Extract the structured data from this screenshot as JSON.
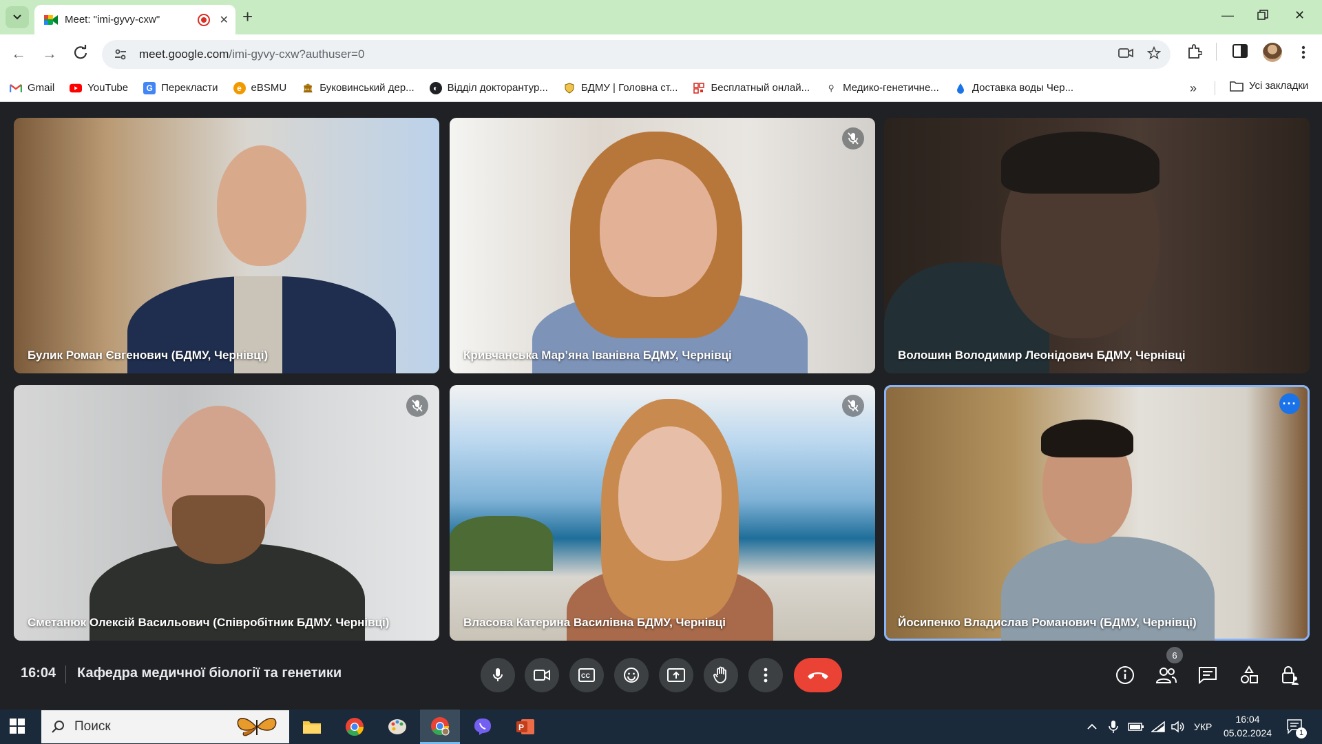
{
  "browser": {
    "tab_title": "Meet: \"imi-gyvy-cxw\"",
    "url_main": "meet.google.com",
    "url_path": "/imi-gyvy-cxw?authuser=0",
    "bookmarks": [
      {
        "label": "Gmail",
        "icon": "gmail-icon",
        "color": "#ea4335"
      },
      {
        "label": "YouTube",
        "icon": "youtube-icon",
        "color": "#ff0000"
      },
      {
        "label": "Перекласти",
        "icon": "translate-icon",
        "color": "#4285f4"
      },
      {
        "label": "eBSMU",
        "icon": "ebsmu-icon",
        "color": "#f29900"
      },
      {
        "label": "Буковинський дер...",
        "icon": "university-icon",
        "color": "#a06a00"
      },
      {
        "label": "Відділ докторантур...",
        "icon": "globe-icon",
        "color": "#202124"
      },
      {
        "label": "БДМУ | Головна ст...",
        "icon": "shield-icon",
        "color": "#b58100"
      },
      {
        "label": "Бесплатный онлай...",
        "icon": "qr-icon",
        "color": "#d93025"
      },
      {
        "label": "Медико-генетичне...",
        "icon": "dna-icon",
        "color": "#444444"
      },
      {
        "label": "Доставка воды Чер...",
        "icon": "water-drop-icon",
        "color": "#1a73e8"
      }
    ],
    "all_bookmarks": "Усі закладки"
  },
  "meet": {
    "participants": [
      {
        "name": "Булик Роман Євгенович (БДМУ, Чернівці)",
        "muted": false
      },
      {
        "name": "Кривчанська Мар’яна Іванівна БДМУ, Чернівці",
        "muted": true
      },
      {
        "name": "Волошин Володимир Леонідович БДМУ, Чернівці",
        "muted": false
      },
      {
        "name": "Сметанюк Олексій Васильович (Співробітник БДМУ. Чернівці)",
        "muted": true
      },
      {
        "name": "Власова Катерина Василівна БДМУ, Чернівці",
        "muted": true
      },
      {
        "name": "Йосипенко Владислав Романович (БДМУ, Чернівці)",
        "muted": false
      }
    ],
    "time": "16:04",
    "meeting_name": "Кафедра медичної біології та генетики",
    "people_count": "6",
    "accent_color": "#8ab4f8",
    "hangup_color": "#ea4335"
  },
  "taskbar": {
    "search_placeholder": "Поиск",
    "language": "УКР",
    "time": "16:04",
    "date": "05.02.2024",
    "notifications": "1"
  }
}
